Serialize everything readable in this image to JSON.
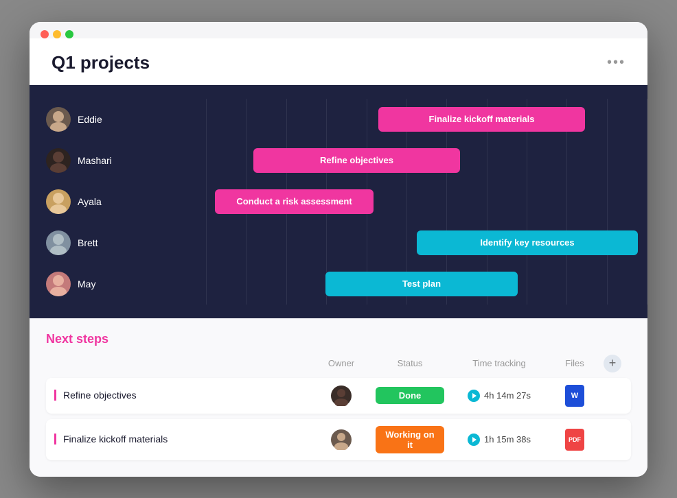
{
  "window": {
    "title": "Q1 projects",
    "dots": [
      "red",
      "yellow",
      "green"
    ],
    "more_label": "•••"
  },
  "gantt": {
    "people": [
      {
        "name": "Eddie",
        "initials": "E",
        "color": "#7c6b5a"
      },
      {
        "name": "Mashari",
        "initials": "M",
        "color": "#3a2d28"
      },
      {
        "name": "Ayala",
        "initials": "A",
        "color": "#c8a07a"
      },
      {
        "name": "Brett",
        "initials": "B",
        "color": "#8a9aaa"
      },
      {
        "name": "May",
        "initials": "M2",
        "color": "#c47a7a"
      }
    ],
    "bars": [
      {
        "label": "Finalize kickoff materials",
        "color": "pink",
        "left": "44%",
        "width": "43%"
      },
      {
        "label": "Refine objectives",
        "color": "pink",
        "left": "18%",
        "width": "43%"
      },
      {
        "label": "Conduct a risk assessment",
        "color": "pink",
        "left": "10%",
        "width": "33%"
      },
      {
        "label": "Identify key resources",
        "color": "cyan",
        "left": "52%",
        "width": "46%"
      },
      {
        "label": "Test plan",
        "color": "cyan",
        "left": "33%",
        "width": "40%"
      }
    ],
    "grid_cols": 12
  },
  "next_steps": {
    "title": "Next steps",
    "columns": {
      "owner": "Owner",
      "status": "Status",
      "time_tracking": "Time tracking",
      "files": "Files"
    },
    "rows": [
      {
        "task": "Refine objectives",
        "owner_initials": "M",
        "owner_color": "#3a2d28",
        "status": "Done",
        "status_type": "done",
        "time": "4h 14m 27s",
        "file_label": "W",
        "file_type": "word"
      },
      {
        "task": "Finalize kickoff materials",
        "owner_initials": "E",
        "owner_color": "#7c6b5a",
        "status": "Working on it",
        "status_type": "working",
        "time": "1h 15m 38s",
        "file_label": "PDF",
        "file_type": "pdf"
      }
    ],
    "add_label": "+"
  }
}
